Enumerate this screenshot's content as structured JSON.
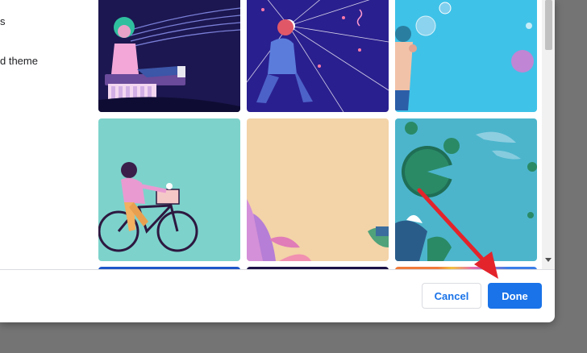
{
  "sidebar": {
    "items": [
      {
        "label": "s"
      },
      {
        "label": "d theme"
      }
    ]
  },
  "gallery": {
    "tiles": [
      {
        "name": "keyboard-musician-artwork"
      },
      {
        "name": "starburst-figure-artwork"
      },
      {
        "name": "bubbles-figure-artwork"
      },
      {
        "name": "bicycle-rider-artwork"
      },
      {
        "name": "beige-plants-artwork"
      },
      {
        "name": "koi-pond-artwork"
      }
    ]
  },
  "footer": {
    "cancel_label": "Cancel",
    "done_label": "Done"
  },
  "colors": {
    "accent": "#1a73e8",
    "annotation_arrow": "#e3242b"
  }
}
